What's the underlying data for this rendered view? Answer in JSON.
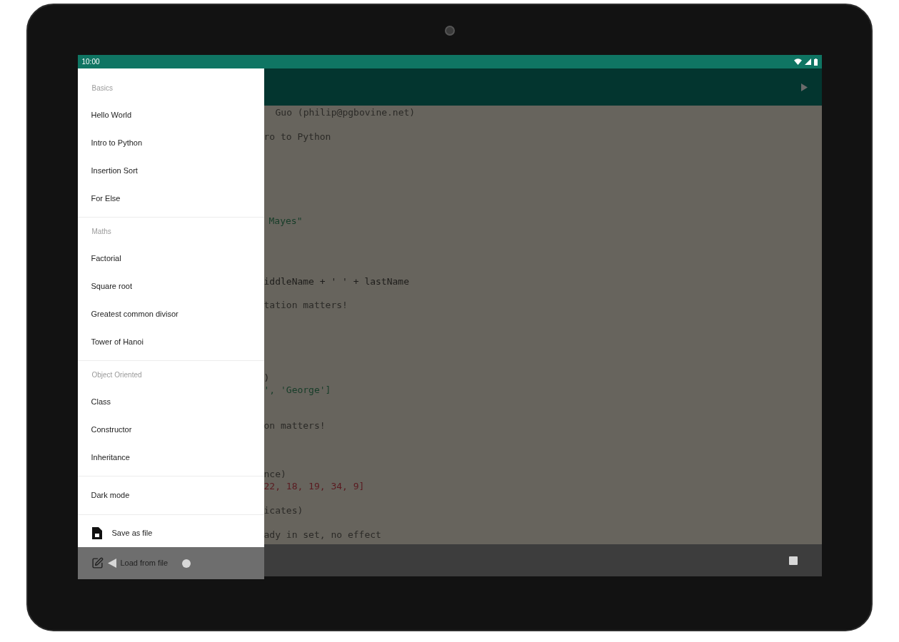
{
  "status_bar": {
    "time": "10:00"
  },
  "drawer": {
    "sections": [
      {
        "header": "Basics",
        "items": [
          {
            "label": "Hello World"
          },
          {
            "label": "Intro to Python"
          },
          {
            "label": "Insertion Sort"
          },
          {
            "label": "For Else"
          }
        ]
      },
      {
        "header": "Maths",
        "items": [
          {
            "label": "Factorial"
          },
          {
            "label": "Square root"
          },
          {
            "label": "Greatest common divisor"
          },
          {
            "label": "Tower of Hanoi"
          }
        ]
      },
      {
        "header": "Object Oriented",
        "items": [
          {
            "label": "Class"
          },
          {
            "label": "Constructor"
          },
          {
            "label": "Inheritance"
          }
        ]
      },
      {
        "items": [
          {
            "label": "Dark mode"
          }
        ]
      }
    ],
    "actions": [
      {
        "label": "Save as file",
        "kind": "save"
      },
      {
        "label": "Load from file",
        "kind": "load"
      }
    ]
  },
  "editor": {
    "lines": [
      {
        "text": "Guo (philip@pgbovine.net)",
        "kind": "comment"
      },
      {
        "text": "ro to Python",
        "kind": "comment"
      },
      {
        "text": "Mayes\"",
        "kind": "string"
      },
      {
        "text": "iddleName + ' ' + lastName",
        "kind": "code"
      },
      {
        "text": "tation matters!",
        "kind": "comment"
      },
      {
        "text": ")",
        "kind": "code"
      },
      {
        "text": "', 'George']",
        "kind": "string"
      },
      {
        "text": "on matters!",
        "kind": "comment"
      },
      {
        "text": "nce)",
        "kind": "comment"
      },
      {
        "text": "22, 18, 19, 34, 9]",
        "kind": "number"
      },
      {
        "text": "icates)",
        "kind": "comment"
      },
      {
        "text": "ady in set, no effect",
        "kind": "comment"
      }
    ]
  }
}
